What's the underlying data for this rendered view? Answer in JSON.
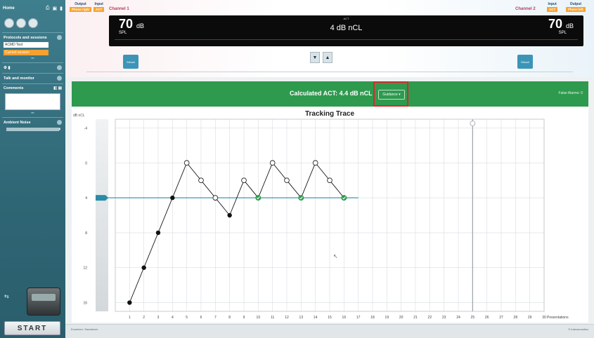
{
  "sidebar": {
    "home_label": "Home",
    "protocols_title": "Protocols and sessions",
    "protocol_value": "ACMD Test",
    "session_value": "Current session",
    "talk_title": "Talk and monitor",
    "comments_title": "Comments",
    "ambient_title": "Ambient Noise",
    "start_label": "START"
  },
  "header": {
    "left_output_label": "Output",
    "left_output_value": "Phone right",
    "left_input_label": "Input",
    "left_input_value": "ACT",
    "channel1_label": "Channel 1",
    "channel2_label": "Channel 2",
    "right_input_label": "Input",
    "right_input_value": "ACT",
    "right_output_label": "Output",
    "right_output_value": "Phone left",
    "level_left_value": "70",
    "level_left_unit": "dB",
    "level_left_scale": "SPL",
    "level_right_value": "70",
    "level_right_unit": "dB",
    "level_right_scale": "SPL",
    "center_caption": "ACT",
    "center_value": "4 dB nCL",
    "left_stim_button": "Stimuli",
    "right_stim_button": "Stimuli",
    "arrow_down": "▼",
    "arrow_up": "▲"
  },
  "results": {
    "calculated_act": "Calculated ACT: 4.4 dB nCL",
    "guidance_label": "Guidance ▾",
    "false_alarms": "False Alarms: 0"
  },
  "footer": {
    "left": "Examiner: Sandstrom",
    "right": "© Interacoustics"
  },
  "chart_data": {
    "type": "line",
    "title": "Tracking Trace",
    "ylabel": "dB nCL",
    "xlabel": "Presentations",
    "y_ticks": [
      -4,
      0,
      4,
      8,
      12,
      16
    ],
    "y_inverted": true,
    "ylim": [
      -5,
      17
    ],
    "x_ticks": [
      1,
      2,
      3,
      4,
      5,
      6,
      7,
      8,
      9,
      10,
      11,
      12,
      13,
      14,
      15,
      16,
      17,
      18,
      19,
      20,
      21,
      22,
      23,
      24,
      25,
      26,
      27,
      28,
      29,
      30
    ],
    "xlim": [
      0,
      30
    ],
    "grid": true,
    "reference_level": 4,
    "marker_presentation": 25,
    "series": [
      {
        "x": [
          1,
          2,
          3,
          4,
          5,
          6,
          7,
          8,
          9,
          10,
          11,
          12,
          13,
          14,
          15,
          16
        ],
        "y": [
          16,
          12,
          8,
          4,
          0,
          2,
          4,
          6,
          2,
          4,
          0,
          2,
          4,
          0,
          2,
          4
        ],
        "markers": [
          "filled",
          "filled",
          "filled",
          "filled",
          "open",
          "open",
          "open",
          "filled",
          "open",
          "accepted",
          "open",
          "open",
          "accepted",
          "open",
          "open",
          "accepted"
        ]
      }
    ],
    "colors": {
      "line": "#1a1a1a",
      "reference": "#2a8ba6",
      "accepted": "#2e9a4e",
      "grid": "#d8dde0"
    }
  }
}
